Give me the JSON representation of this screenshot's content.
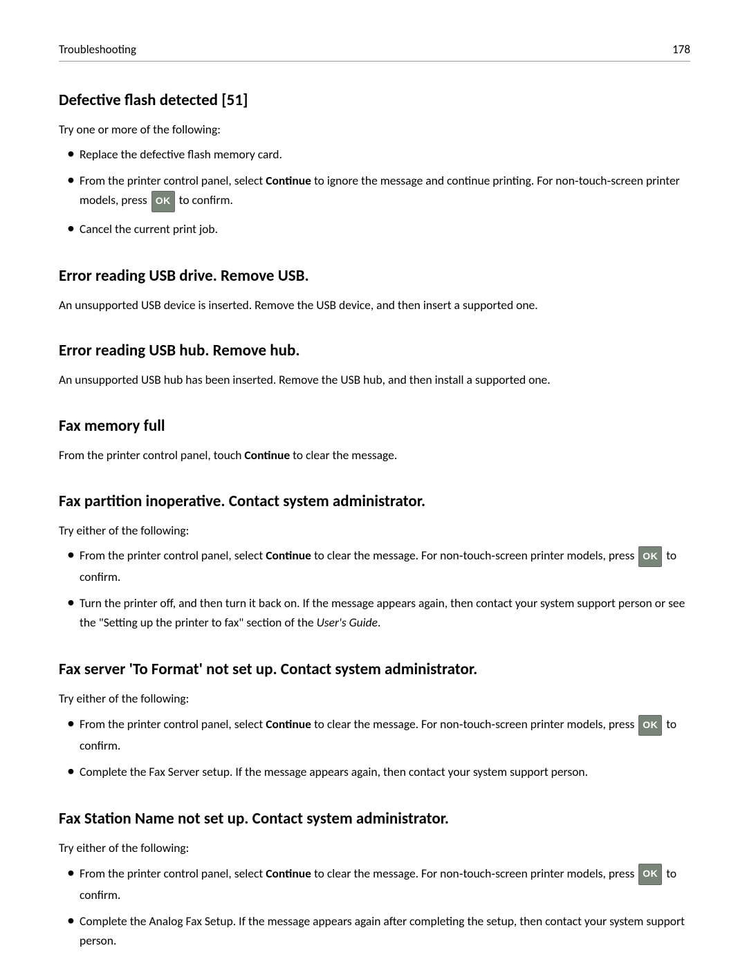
{
  "header": {
    "section": "Troubleshooting",
    "page": "178"
  },
  "ok_label": "OK",
  "sections": {
    "s1": {
      "title": "Defective flash detected [51]",
      "intro": "Try one or more of the following:",
      "bullets": {
        "b1": "Replace the defective flash memory card.",
        "b2a": "From the printer control panel, select ",
        "b2_bold": "Continue",
        "b2b": " to ignore the message and continue printing. For non‑touch‑screen printer models, press ",
        "b2c": " to confirm.",
        "b3": "Cancel the current print job."
      }
    },
    "s2": {
      "title": "Error reading USB drive. Remove USB.",
      "body": "An unsupported USB device is inserted. Remove the USB device, and then insert a supported one."
    },
    "s3": {
      "title": "Error reading USB hub. Remove hub.",
      "body": "An unsupported USB hub has been inserted. Remove the USB hub, and then install a supported one."
    },
    "s4": {
      "title": "Fax memory full",
      "body_a": "From the printer control panel, touch ",
      "body_bold": "Continue",
      "body_b": " to clear the message."
    },
    "s5": {
      "title": "Fax partition inoperative. Contact system administrator.",
      "intro": "Try either of the following:",
      "bullets": {
        "b1a": "From the printer control panel, select ",
        "b1_bold": "Continue",
        "b1b": " to clear the message. For non‑touch‑screen printer models, press ",
        "b1c": " to confirm.",
        "b2a": "Turn the printer off, and then turn it back on. If the message appears again, then contact your system support person or see the \"Setting up the printer to fax\" section of the ",
        "b2_italic": "User's Guide",
        "b2b": "."
      }
    },
    "s6": {
      "title": "Fax server 'To Format' not set up. Contact system administrator.",
      "intro": "Try either of the following:",
      "bullets": {
        "b1a": "From the printer control panel, select ",
        "b1_bold": "Continue",
        "b1b": " to clear the message. For non‑touch‑screen printer models, press ",
        "b1c": " to confirm.",
        "b2": "Complete the Fax Server setup. If the message appears again, then contact your system support person."
      }
    },
    "s7": {
      "title": "Fax Station Name not set up. Contact system administrator.",
      "intro": "Try either of the following:",
      "bullets": {
        "b1a": "From the printer control panel, select ",
        "b1_bold": "Continue",
        "b1b": " to clear the message. For non‑touch‑screen printer models, press ",
        "b1c": " to confirm.",
        "b2": "Complete the Analog Fax Setup. If the message appears again after completing the setup, then contact your system support person."
      }
    }
  }
}
